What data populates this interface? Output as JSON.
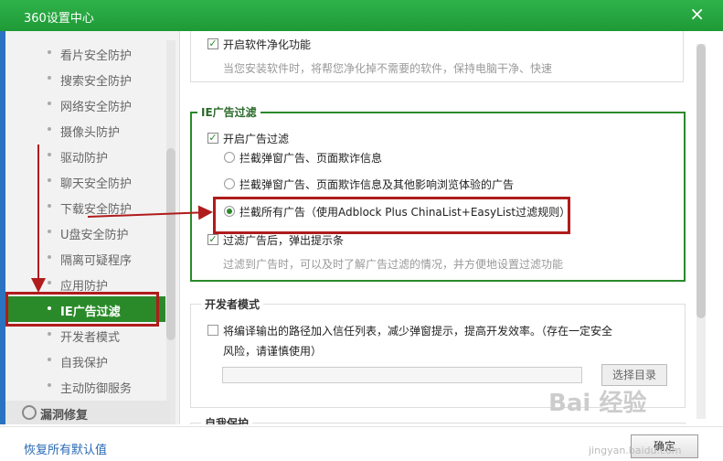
{
  "window": {
    "title": "360设置中心",
    "close_icon": "×"
  },
  "sidebar": {
    "items": [
      {
        "label": "看片安全防护"
      },
      {
        "label": "搜索安全防护"
      },
      {
        "label": "网络安全防护"
      },
      {
        "label": "摄像头防护"
      },
      {
        "label": "驱动防护"
      },
      {
        "label": "聊天安全防护"
      },
      {
        "label": "下载安全防护"
      },
      {
        "label": "U盘安全防护"
      },
      {
        "label": "隔离可疑程序"
      },
      {
        "label": "应用防护"
      },
      {
        "label": "IE广告过滤"
      },
      {
        "label": "开发者模式"
      },
      {
        "label": "自我保护"
      },
      {
        "label": "主动防御服务"
      }
    ],
    "active_index": 10,
    "category": "漏洞修复"
  },
  "content": {
    "software_clean": {
      "label": "开启软件净化功能",
      "hint": "当您安装软件时，将帮您净化掉不需要的软件，保持电脑干净、快速"
    },
    "ie_filter": {
      "title": "IE广告过滤",
      "enable_label": "开启广告过滤",
      "options": [
        "拦截弹窗广告、页面欺诈信息",
        "拦截弹窗广告、页面欺诈信息及其他影响浏览体验的广告",
        "拦截所有广告（使用Adblock Plus ChinaList+EasyList过滤规则）"
      ],
      "selected_option": 2,
      "notify_label": "过滤广告后，弹出提示条",
      "notify_hint": "过滤到广告时，可以及时了解广告过滤的情况，并方便地设置过滤功能"
    },
    "dev_mode": {
      "title": "开发者模式",
      "label_line1": "将编译输出的路径加入信任列表，减少弹窗提示，提高开发效率。（存在一定安全",
      "label_line2": "风险，请谨慎使用）",
      "path_value": "",
      "browse_button": "选择目录"
    },
    "self_protect": {
      "title": "自我保护"
    }
  },
  "footer": {
    "reset_link": "恢复所有默认值",
    "ok_button": "确定"
  },
  "watermark": {
    "text": "Bai 经验",
    "sub": "jingyan.baidu.com"
  },
  "colors": {
    "accent": "#2a8a2a",
    "annotation": "#b01c1c",
    "title_bar": "#26a63f"
  }
}
